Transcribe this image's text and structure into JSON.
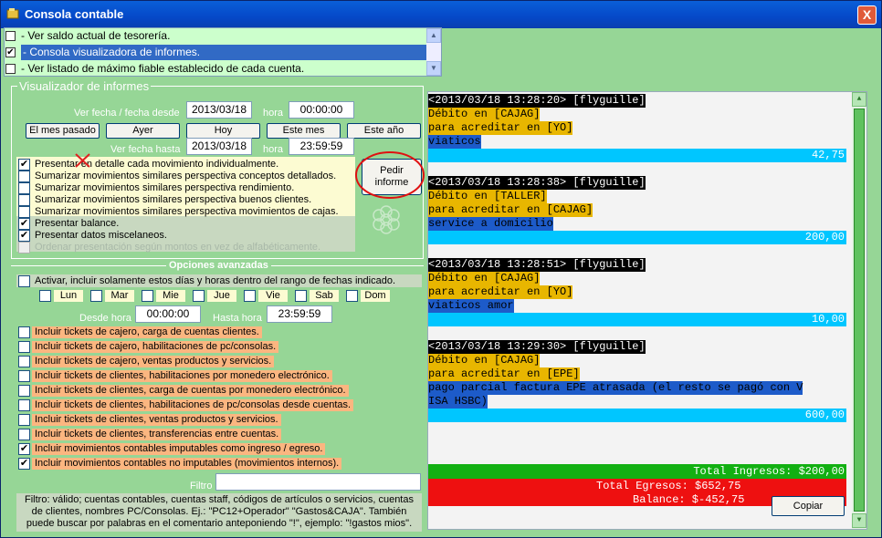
{
  "window": {
    "title": "Consola contable",
    "close_label": "X"
  },
  "list": [
    {
      "checked": false,
      "label": "- Ver saldo actual de tesorería.",
      "selected": false
    },
    {
      "checked": true,
      "label": "- Consola visualizadora de informes.",
      "selected": true
    },
    {
      "checked": false,
      "label": "- Ver listado de máximo fiable establecido de cada cuenta.",
      "selected": false
    }
  ],
  "viewer": {
    "group_label": "Visualizador de informes",
    "desde_label": "Ver fecha / fecha desde",
    "desde_date": "2013/03/18",
    "hora_label": "hora",
    "desde_time": "00:00:00",
    "hasta_label": "Ver fecha hasta",
    "hasta_date": "2013/03/18",
    "hasta_time": "23:59:59",
    "buttons": [
      "El mes pasado",
      "Ayer",
      "Hoy",
      "Este mes",
      "Este año"
    ],
    "pedir_label": "Pedir informe",
    "options": [
      {
        "checked": true,
        "label": "Presentar en detalle cada movimiento individualmente.",
        "disabled": false
      },
      {
        "checked": false,
        "label": "Sumarizar movimientos similares perspectiva conceptos detallados.",
        "disabled": false
      },
      {
        "checked": false,
        "label": "Sumarizar movimientos similares perspectiva rendimiento.",
        "disabled": false
      },
      {
        "checked": false,
        "label": "Sumarizar movimientos similares perspectiva buenos clientes.",
        "disabled": false
      },
      {
        "checked": false,
        "label": "Sumarizar movimientos similares perspectiva movimientos de cajas.",
        "disabled": false
      },
      {
        "checked": true,
        "label": "Presentar balance.",
        "disabled": false
      },
      {
        "checked": true,
        "label": "Presentar datos miscelaneos.",
        "disabled": false
      },
      {
        "checked": false,
        "label": "Ordenar presentación según montos en vez de alfabéticamente.",
        "disabled": true
      }
    ]
  },
  "advanced": {
    "title": "Opciones avanzadas",
    "activate_label": "Activar, incluir solamente estos días y horas dentro del rango de fechas indicado.",
    "days": [
      "Lun",
      "Mar",
      "Mie",
      "Jue",
      "Vie",
      "Sab",
      "Dom"
    ],
    "desde_hora_label": "Desde hora",
    "desde_hora": "00:00:00",
    "hasta_hora_label": "Hasta hora",
    "hasta_hora": "23:59:59",
    "includes": [
      {
        "checked": false,
        "label": "Incluir tickets de cajero, carga de cuentas clientes."
      },
      {
        "checked": false,
        "label": "Incluir tickets de cajero, habilitaciones de pc/consolas."
      },
      {
        "checked": false,
        "label": "Incluir tickets de cajero, ventas productos y servicios."
      },
      {
        "checked": false,
        "label": "Incluir tickets de clientes, habilitaciones por monedero electrónico."
      },
      {
        "checked": false,
        "label": "Incluir tickets de clientes, carga de cuentas por monedero electrónico."
      },
      {
        "checked": false,
        "label": "Incluir tickets de clientes, habilitaciones de pc/consolas desde cuentas."
      },
      {
        "checked": false,
        "label": "Incluir tickets de clientes, ventas productos y servicios."
      },
      {
        "checked": false,
        "label": "Incluir tickets de clientes, transferencias entre cuentas."
      },
      {
        "checked": true,
        "label": "Incluir movimientos contables imputables como ingreso / egreso."
      },
      {
        "checked": true,
        "label": "Incluir movimientos contables no imputables (movimientos internos)."
      }
    ],
    "filter_label": "Filtro",
    "filter_value": "",
    "filter_help": "Filtro: válido; cuentas contables, cuentas staff, códigos de artículos o servicios, cuentas de clientes, nombres PC/Consolas. Ej.: \"PC12+Operador\" \"Gastos&CAJA\". También puede buscar por palabras en el comentario anteponiendo \"!\", ejemplo: \"!gastos mios\"."
  },
  "report": {
    "entries": [
      {
        "header": "<2013/03/18 13:28:20> [flyguille]",
        "line1": "Débito en [CAJAG]",
        "line2": "para acreditar en [YO]",
        "comment": [
          "viaticos"
        ],
        "amount": "42,75"
      },
      {
        "header": "<2013/03/18 13:28:38> [flyguille]",
        "line1": "Débito en [TALLER]",
        "line2": "para acreditar en [CAJAG]",
        "comment": [
          "service a domicilio"
        ],
        "amount": "200,00"
      },
      {
        "header": "<2013/03/18 13:28:51> [flyguille]",
        "line1": "Débito en [CAJAG]",
        "line2": "para acreditar en [YO]",
        "comment": [
          "viaticos amor"
        ],
        "amount": "10,00"
      },
      {
        "header": "<2013/03/18 13:29:30> [flyguille]",
        "line1": "Débito en [CAJAG]",
        "line2": "para acreditar en [EPE]",
        "comment": [
          "pago parcial factura EPE atrasada (el resto se pagó con V",
          "ISA HSBC)"
        ],
        "amount": "600,00"
      }
    ],
    "total_ingresos": "Total Ingresos: $200,00",
    "total_egresos": "Total Egresos: $652,75",
    "balance": "Balance: $-452,75",
    "copiar_label": "Copiar"
  },
  "colors": {
    "window_bg": "#96d696",
    "report_gold": "#e8b600",
    "report_blue": "#1d5bc9",
    "report_cyan": "#00c6ff",
    "ingresos_green": "#12b012",
    "egresos_red": "#ee1010"
  }
}
